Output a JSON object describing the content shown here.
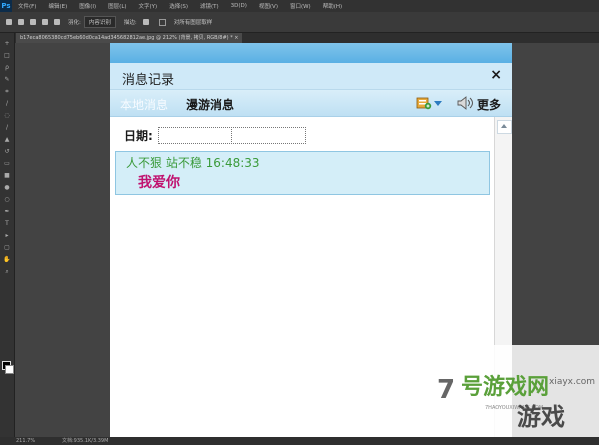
{
  "photoshop": {
    "logo": "Ps",
    "menus": [
      "文件(F)",
      "编辑(E)",
      "图像(I)",
      "图层(L)",
      "文字(Y)",
      "选择(S)",
      "滤镜(T)",
      "3D(D)",
      "视图(V)",
      "窗口(W)",
      "帮助(H)"
    ],
    "options": {
      "feather_label": "羽化:",
      "feather_value": "内容识别",
      "sample_label": "描边:",
      "all_layers_label": "对所有图层取样"
    },
    "doc_tab": "b17eca8065380cd75eb60d0ca14ad345682812ae.jpg @ 212% (背景, 拷贝, RGB/8#) * ×",
    "status": {
      "zoom": "211.7%",
      "doc": "文档:935.1K/3.39M"
    }
  },
  "dialog": {
    "title": "消息记录",
    "close_symbol": "×",
    "tabs": {
      "local": "本地消息",
      "roaming": "漫游消息"
    },
    "more_label": "更多",
    "date_label": "日期:",
    "message": {
      "sender_time": "人不狠 站不稳 16:48:33",
      "text": "我爱你"
    }
  },
  "watermark": {
    "number": "7",
    "brand": "号游戏网",
    "domain": "xiayx.com",
    "pinyin": "7HAOYOUXIWANG.COM",
    "game": "游戏"
  },
  "colors": {
    "accent": "#5ab0e4",
    "message_meta": "#3a9a3a",
    "message_text": "#c0126f"
  }
}
